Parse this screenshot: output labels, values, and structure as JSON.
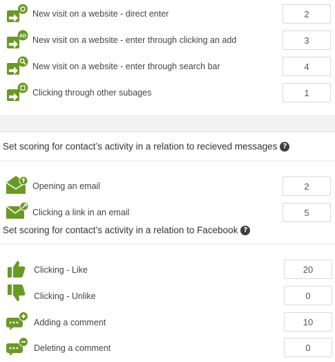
{
  "website": {
    "items": [
      {
        "label": "New visit on a website - direct enter",
        "value": "2",
        "icon": "website-direct-icon"
      },
      {
        "label": "New visit on a website - enter through clicking an add",
        "value": "3",
        "icon": "website-ad-icon",
        "badge": "AD"
      },
      {
        "label": "New visit on a website - enter through search bar",
        "value": "4",
        "icon": "website-search-icon"
      },
      {
        "label": "Clicking through other subages",
        "value": "1",
        "icon": "website-subpages-icon"
      }
    ]
  },
  "messages": {
    "heading": "Set scoring for contact’s activity in a relation to recieved messages",
    "help": "?",
    "items": [
      {
        "label": "Opening an email",
        "value": "2",
        "icon": "email-open-icon"
      },
      {
        "label": "Clicking a link in an email",
        "value": "5",
        "icon": "email-link-icon"
      }
    ]
  },
  "facebook": {
    "heading": "Set scoring for contact’s activity in a relation to Facebook",
    "help": "?",
    "items": [
      {
        "label": "Clicking - Like",
        "value": "20",
        "icon": "thumbs-up-icon"
      },
      {
        "label": "Clicking - Unlike",
        "value": "0",
        "icon": "thumbs-down-icon"
      },
      {
        "label": "Adding a comment",
        "value": "10",
        "icon": "comment-add-icon"
      },
      {
        "label": "Deleting a comment",
        "value": "0",
        "icon": "comment-delete-icon"
      }
    ]
  },
  "colors": {
    "icon_green": "#6a9a25",
    "text": "#444444",
    "help_badge": "#404040"
  }
}
